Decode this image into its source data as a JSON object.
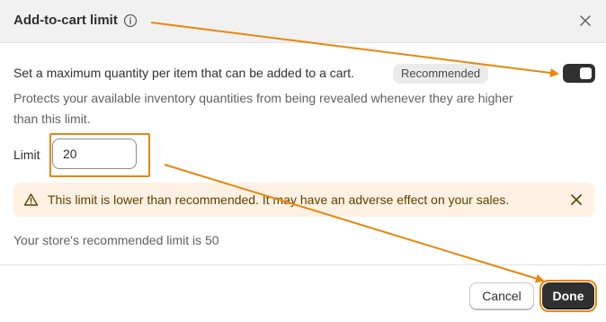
{
  "modal": {
    "title": "Add-to-cart limit",
    "description": "Set a maximum quantity per item that can be added to a cart.",
    "badge": "Recommended",
    "subdescription": "Protects your available inventory quantities from being revealed whenever they are higher than this limit.",
    "toggle_on": true
  },
  "limit": {
    "label": "Limit",
    "value": "20"
  },
  "warning": {
    "text": "This limit is lower than recommended. It may have an adverse effect on your sales."
  },
  "recommended_text": "Your store's recommended limit is 50",
  "footer": {
    "cancel_label": "Cancel",
    "done_label": "Done"
  },
  "colors": {
    "annotation": "#e8860f",
    "primary": "#303030",
    "warning_bg": "#fff1e3",
    "warning_text": "#5e4200"
  },
  "icons": [
    "info-icon",
    "close-icon",
    "warning-icon",
    "dismiss-icon"
  ]
}
